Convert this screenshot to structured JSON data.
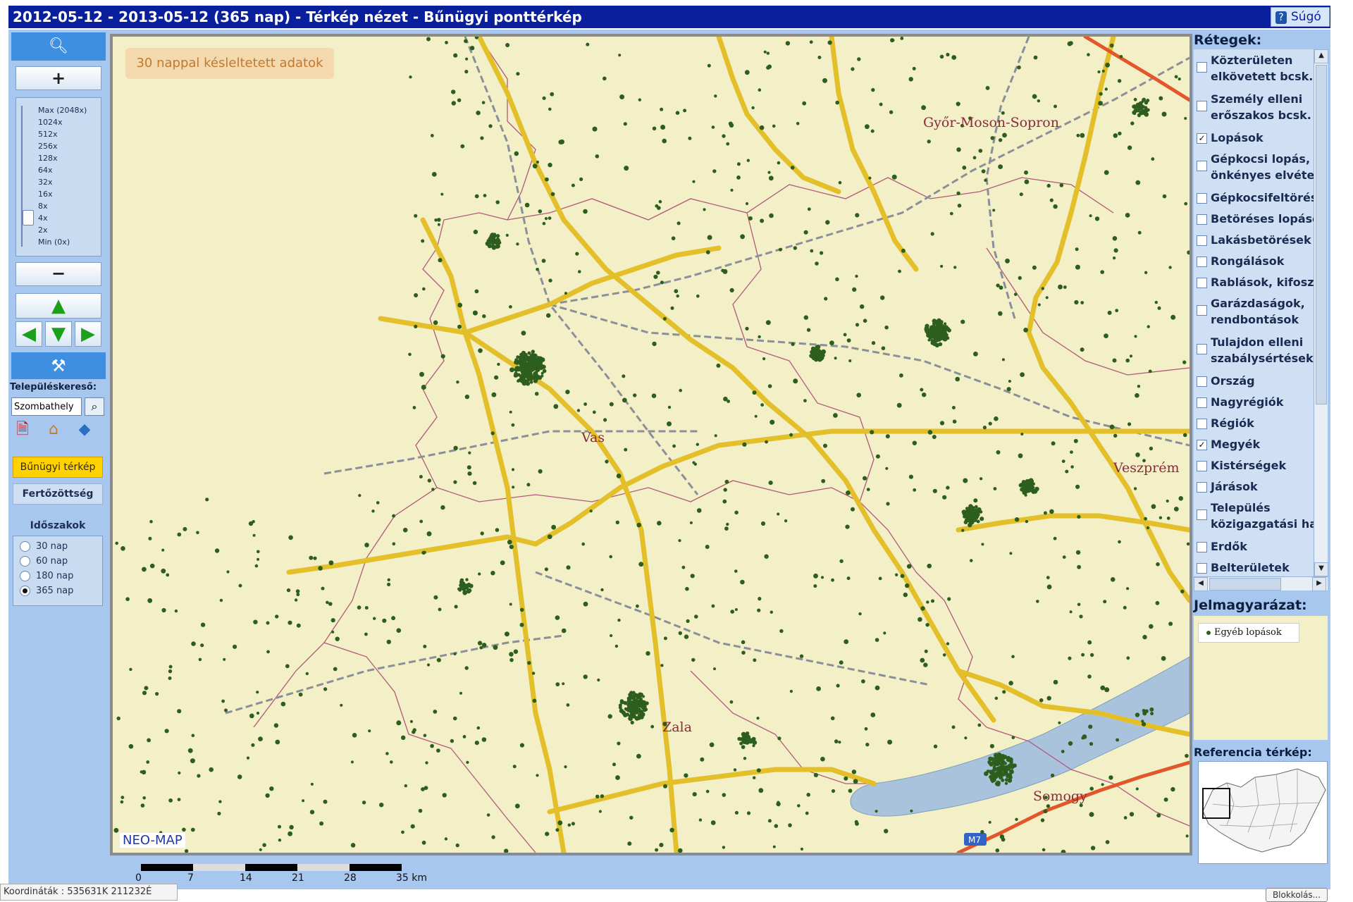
{
  "window": {
    "title": "2012-05-12 - 2013-05-12 (365 nap) - Térkép nézet - Bűnügyi ponttérkép",
    "help_label": "Súgó"
  },
  "toolbar": {
    "zoom_levels": [
      "Max (2048x)",
      "1024x",
      "512x",
      "256x",
      "128x",
      "64x",
      "32x",
      "16x",
      "8x",
      "4x",
      "2x",
      "Min (0x)"
    ],
    "settlement_search_label": "Településkereső:",
    "settlement_search_value": "Szombathely",
    "crime_map_button": "Bűnügyi térkép",
    "infection_button": "Fertőzöttség",
    "periods_title": "Időszakok",
    "periods": [
      {
        "label": "30 nap",
        "selected": false
      },
      {
        "label": "60 nap",
        "selected": false
      },
      {
        "label": "180 nap",
        "selected": false
      },
      {
        "label": "365 nap",
        "selected": true
      }
    ]
  },
  "map": {
    "delay_note": "30 nappal késleltetett adatok",
    "brand": "NEO-MAP",
    "counties": [
      "Győr-Moson-Sopron",
      "Vas",
      "Veszprém",
      "Zala",
      "Somogy"
    ],
    "motorway_label": "M7",
    "point_color": "#2e5e1e",
    "background_color": "#f3efc6",
    "lake_color": "#a9c3dd",
    "road_color": "#e3bf2a",
    "scale_labels": [
      "0",
      "7",
      "14",
      "21",
      "28",
      "35 km"
    ]
  },
  "layers": {
    "title": "Rétegek:",
    "items": [
      {
        "label": "Közterületen",
        "label2": "elkövetett bcsk.",
        "checked": false
      },
      {
        "label": "Személy elleni",
        "label2": "erőszakos bcsk.",
        "checked": false
      },
      {
        "label": "Lopások",
        "checked": true
      },
      {
        "label": "Gépkocsi lopás, j",
        "label2": "önkényes elvétele",
        "checked": false
      },
      {
        "label": "Gépkocsifeltörés",
        "checked": false
      },
      {
        "label": "Betöréses lopáso",
        "checked": false
      },
      {
        "label": "Lakásbetörések",
        "checked": false
      },
      {
        "label": "Rongálások",
        "checked": false
      },
      {
        "label": "Rablások, kifoszt",
        "checked": false
      },
      {
        "label": "Garázdaságok,",
        "label2": "rendbontások",
        "checked": false
      },
      {
        "label": "Tulajdon elleni",
        "label2": "szabálysértések",
        "checked": false
      },
      {
        "label": "Ország",
        "checked": false
      },
      {
        "label": "Nagyrégiók",
        "checked": false
      },
      {
        "label": "Régiók",
        "checked": false
      },
      {
        "label": "Megyék",
        "checked": true
      },
      {
        "label": "Kistérségek",
        "checked": false
      },
      {
        "label": "Járások",
        "checked": false
      },
      {
        "label": "Település",
        "label2": "közigazgatási hat",
        "checked": false
      },
      {
        "label": "Erdők",
        "checked": false
      },
      {
        "label": "Belterületek",
        "checked": false
      }
    ]
  },
  "legend": {
    "title": "Jelmagyarázat:",
    "item": "Egyéb lopások"
  },
  "reference": {
    "title": "Referencia térkép:"
  },
  "status": {
    "coords": "Koordináták : 535631K 211232É",
    "blocking": "Blokkolás..."
  }
}
